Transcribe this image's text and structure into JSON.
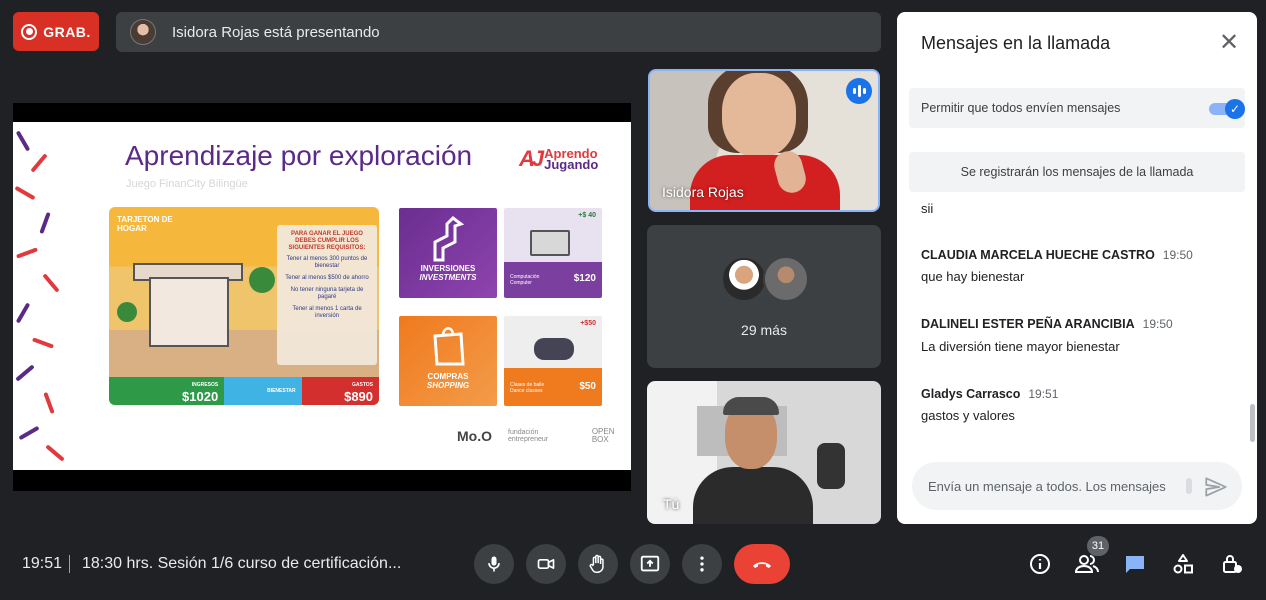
{
  "topbar": {
    "recording_label": "GRAB.",
    "presenting_text": "Isidora Rojas está presentando"
  },
  "slide": {
    "title": "Aprendizaje por exploración",
    "subtitle": "Juego FinanCity Bilingüe",
    "brand_mark": "AJ",
    "brand_line1": "Aprendo",
    "brand_line2": "Jugando",
    "home_card": {
      "label": "TARJETON DE HOGAR",
      "rules_head": "PARA GANAR EL JUEGO DEBES CUMPLIR LOS SIGUIENTES REQUISITOS:",
      "rules": [
        "Tener al menos 300 puntos de bienestar",
        "Tener al menos $500 de ahorro",
        "No tener ninguna tarjeta de pagaré",
        "Tener al menos 1 carta de inversión"
      ],
      "income_label": "INGRESOS",
      "income_value": "$1020",
      "wellbeing_label": "BIENESTAR",
      "expenses_label": "GASTOS",
      "expenses_value": "$890"
    },
    "tiles": {
      "investments_es": "INVERSIONES",
      "investments_en": "INVESTMENTS",
      "computer_sub": "Computación Computer",
      "computer_tag": "+$ 40",
      "computer_price": "$120",
      "shopping_es": "COMPRAS",
      "shopping_en": "SHOPPING",
      "dance_sub": "Clases de baile Dance classes",
      "dance_tag": "+$50",
      "dance_price": "$50"
    },
    "footer_logos": [
      "Mo.O",
      "fundación entrepreneur",
      "OPEN BOX"
    ]
  },
  "participants": {
    "presenter_name": "Isidora Rojas",
    "more_label": "29 más",
    "self_name": "Tú"
  },
  "chat": {
    "title": "Mensajes en la llamada",
    "allow_label": "Permitir que todos envíen mensajes",
    "allow_enabled": true,
    "record_note": "Se registrarán los mensajes de la llamada",
    "partial_message": "sii",
    "messages": [
      {
        "author": "CLAUDIA MARCELA HUECHE CASTRO",
        "time": "19:50",
        "text": "que hay bienestar"
      },
      {
        "author": "DALINELI ESTER PEÑA ARANCIBIA",
        "time": "19:50",
        "text": "La diversión tiene mayor bienestar"
      },
      {
        "author": "Gladys Carrasco",
        "time": "19:51",
        "text": "gastos y valores"
      }
    ],
    "input_placeholder": "Envía un mensaje a todos. Los mensajes"
  },
  "bottombar": {
    "time": "19:51",
    "meeting_title": "18:30 hrs. Sesión 1/6 curso de certificación...",
    "people_count": "31"
  },
  "colors": {
    "accent": "#1a73e8",
    "record": "#d93025",
    "end_call": "#ea4335",
    "slide_purple": "#5b2a86"
  }
}
